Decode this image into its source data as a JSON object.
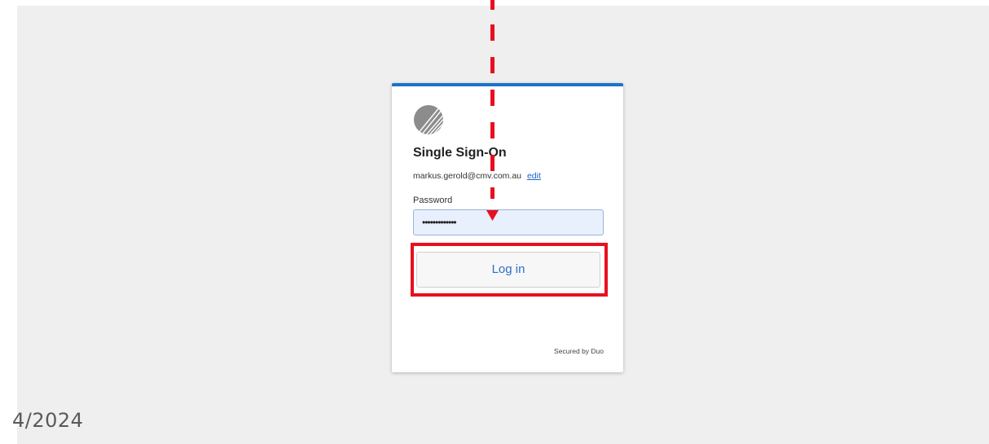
{
  "slide": {
    "date_fragment": "4/2024"
  },
  "login_card": {
    "logo_icon": "brand-logo-icon",
    "title": "Single Sign-On",
    "email": "markus.gerold@cmv.com.au",
    "edit_link": "edit",
    "password_label": "Password",
    "password_value": "•••••••••••••",
    "login_button": "Log in",
    "footer": "Secured by Duo"
  },
  "annotations": {
    "arrow_icon": "dashed-arrow-down-icon",
    "highlight_color": "#e8101f"
  },
  "colors": {
    "accent": "#1a73c9",
    "background": "#efefef",
    "input_fill": "#e8effd"
  }
}
